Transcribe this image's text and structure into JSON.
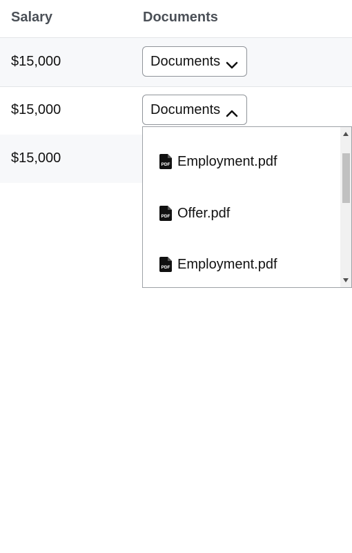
{
  "table": {
    "headers": {
      "salary": "Salary",
      "documents": "Documents"
    },
    "rows": [
      {
        "salary": "$15,000",
        "button_label": "Documents",
        "chevron": "chevron-down-icon"
      },
      {
        "salary": "$15,000",
        "button_label": "Documents",
        "chevron": "chevron-up-icon"
      },
      {
        "salary": "$15,000"
      }
    ]
  },
  "dropdown": {
    "items": [
      {
        "label": "Employment.pdf",
        "icon": "pdf-file-icon"
      },
      {
        "label": "Offer.pdf",
        "icon": "pdf-file-icon"
      },
      {
        "label": "Employment.pdf",
        "icon": "pdf-file-icon"
      }
    ]
  },
  "colors": {
    "header_text": "#4b5057",
    "stripe_background": "#f7f8fa",
    "border": "#e3e5e8"
  }
}
